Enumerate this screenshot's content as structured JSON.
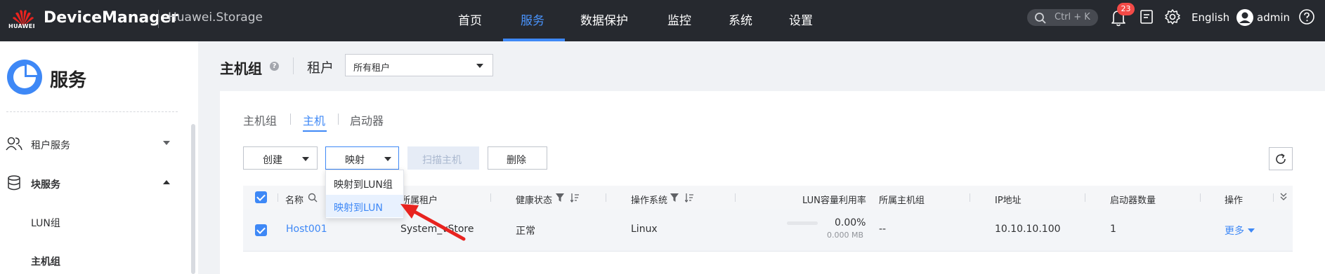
{
  "header": {
    "brand_logo_text": "HUAWEI",
    "app_title": "DeviceManager",
    "product": "Huawei.Storage",
    "nav": [
      "首页",
      "服务",
      "数据保护",
      "监控",
      "系统",
      "设置"
    ],
    "active_nav": "服务",
    "search_shortcut": "Ctrl + K",
    "alarm_count": "23",
    "language": "English",
    "user": "admin"
  },
  "sidebar": {
    "title": "服务",
    "groups": [
      {
        "label": "租户服务",
        "expanded": false
      },
      {
        "label": "块服务",
        "expanded": true
      }
    ],
    "sub_items": [
      "LUN组",
      "主机组"
    ],
    "active_sub_item": "主机组"
  },
  "page": {
    "title": "主机组",
    "tenant_label": "租户",
    "tenant_value": "所有租户",
    "help_symbol": "?"
  },
  "tabs": [
    "主机组",
    "主机",
    "启动器"
  ],
  "active_tab": "主机",
  "toolbar": {
    "create": "创建",
    "map": "映射",
    "scan": "扫描主机",
    "delete": "删除"
  },
  "map_menu": {
    "items": [
      "映射到LUN组",
      "映射到LUN"
    ],
    "hovered": "映射到LUN"
  },
  "table": {
    "columns": [
      "名称",
      "所属租户",
      "健康状态",
      "操作系统",
      "LUN容量利用率",
      "所属主机组",
      "IP地址",
      "启动器数量",
      "操作"
    ],
    "rows": [
      {
        "name": "Host001",
        "tenant": "System_vStore",
        "health": "正常",
        "os": "Linux",
        "lun_usage_percent": "0.00%",
        "lun_usage_capacity": "0.000 MB",
        "lun_usage_fraction": 0.0,
        "host_group": "--",
        "ip": "10.10.10.100",
        "initiators": "1",
        "action": "更多"
      }
    ]
  },
  "colors": {
    "topbar_bg": "#26292f",
    "accent": "#3e88f6",
    "badge": "#f34a47",
    "annotation_arrow": "#e8231f"
  }
}
